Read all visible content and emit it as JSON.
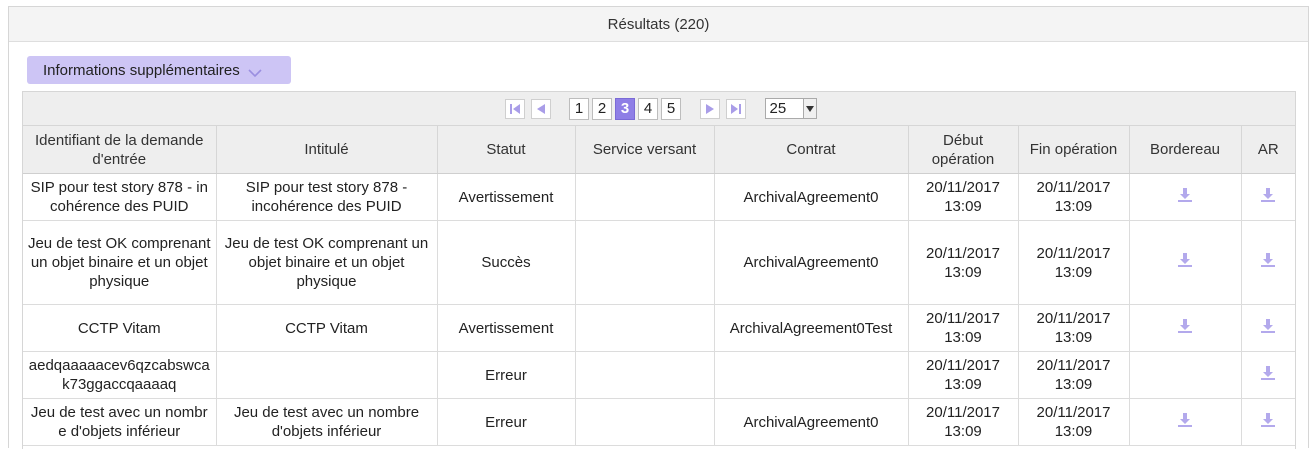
{
  "panel": {
    "title": "Résultats (220)"
  },
  "info_button": {
    "label": "Informations supplémentaires"
  },
  "pager": {
    "pages": [
      "1",
      "2",
      "3",
      "4",
      "5"
    ],
    "active_page": "3",
    "page_size": "25"
  },
  "columns": [
    "Identifiant de la demande d'entrée",
    "Intitulé",
    "Statut",
    "Service versant",
    "Contrat",
    "Début opération",
    "Fin opération",
    "Bordereau",
    "AR"
  ],
  "rows": [
    {
      "id": "SIP pour test story 878 - incohérence des PUID",
      "intitule": "SIP pour test story 878 - incohérence des PUID",
      "statut": "Avertissement",
      "service": "",
      "contrat": "ArchivalAgreement0",
      "debut": "20/11/2017 13:09",
      "fin": "20/11/2017 13:09",
      "bordereau": true,
      "ar": true
    },
    {
      "id": "Jeu de test OK comprenant un objet binaire et un objet physique",
      "intitule": "Jeu de test OK comprenant un objet binaire et un objet physique",
      "statut": "Succès",
      "service": "",
      "contrat": "ArchivalAgreement0",
      "debut": "20/11/2017 13:09",
      "fin": "20/11/2017 13:09",
      "bordereau": true,
      "ar": true
    },
    {
      "id": "CCTP Vitam",
      "intitule": "CCTP Vitam",
      "statut": "Avertissement",
      "service": "",
      "contrat": "ArchivalAgreement0Test",
      "debut": "20/11/2017 13:09",
      "fin": "20/11/2017 13:09",
      "bordereau": true,
      "ar": true
    },
    {
      "id": "aedqaaaaacev6qzcabswcak73ggaccqaaaaq",
      "intitule": "",
      "statut": "Erreur",
      "service": "",
      "contrat": "",
      "debut": "20/11/2017 13:09",
      "fin": "20/11/2017 13:09",
      "bordereau": false,
      "ar": true
    },
    {
      "id": "Jeu de test avec un nombre d'objets inférieur",
      "intitule": "Jeu de test avec un nombre d'objets inférieur",
      "statut": "Erreur",
      "service": "",
      "contrat": "ArchivalAgreement0",
      "debut": "20/11/2017 13:09",
      "fin": "20/11/2017 13:09",
      "bordereau": true,
      "ar": true
    }
  ],
  "colors": {
    "accent": "#8e7ee6",
    "button_bg": "#cdc5f5",
    "icon": "#a99de8",
    "header_bg": "#eeeeee"
  },
  "icons": {
    "first": "first-page-icon",
    "prev": "prev-page-icon",
    "next": "next-page-icon",
    "last": "last-page-icon",
    "download": "download-icon",
    "chevron": "chevron-down-icon"
  }
}
